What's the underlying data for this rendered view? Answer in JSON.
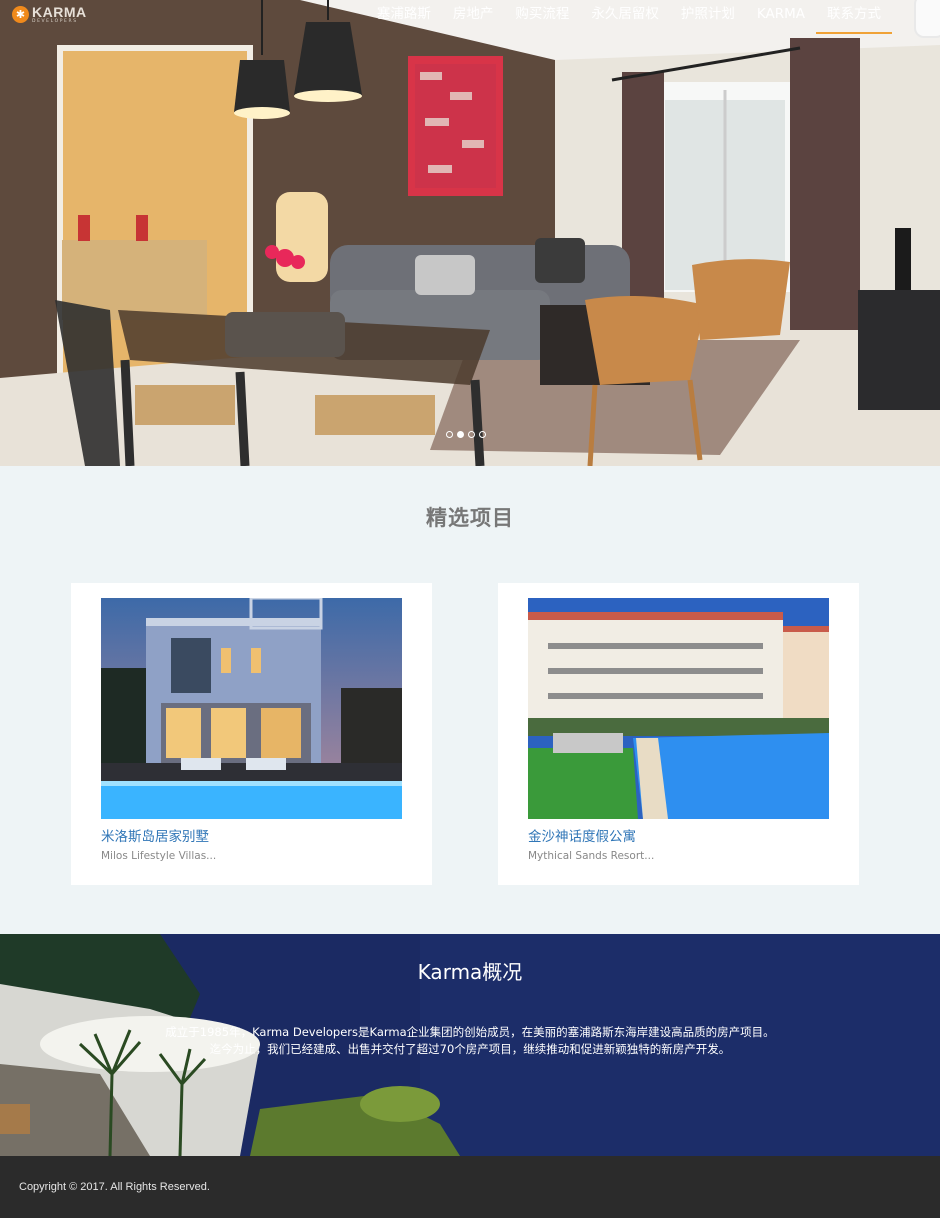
{
  "brand": {
    "name": "KARMA",
    "tagline": "DEVELOPERS",
    "accent": "#f08a1c"
  },
  "nav": {
    "items": [
      {
        "label": "塞浦路斯"
      },
      {
        "label": "房地产"
      },
      {
        "label": "购买流程"
      },
      {
        "label": "永久居留权"
      },
      {
        "label": "护照计划"
      },
      {
        "label": "KARMA"
      },
      {
        "label": "联系方式",
        "active": true
      }
    ]
  },
  "hero": {
    "slides": 4,
    "active_slide": 2
  },
  "featured": {
    "title": "精选项目",
    "projects": [
      {
        "title": "米洛斯岛居家别墅",
        "subtitle": "Milos Lifestyle Villas..."
      },
      {
        "title": "金沙神话度假公寓",
        "subtitle": "Mythical Sands Resort..."
      }
    ]
  },
  "about": {
    "title": "Karma概况",
    "line1": "成立于1985年，Karma Developers是Karma企业集团的创始成员，在美丽的塞浦路斯东海岸建设高品质的房产项目。",
    "line2": "迄今为止，我们已经建成、出售并交付了超过70个房产项目，继续推动和促进新颖独特的新房产开发。"
  },
  "footer": {
    "copyright": "Copyright © 2017. All Rights Reserved."
  },
  "colors": {
    "link": "#3076b7",
    "nav_underline": "#f0a236",
    "footer_bg": "#2b2b2b",
    "section_bg": "#eef4f6"
  }
}
